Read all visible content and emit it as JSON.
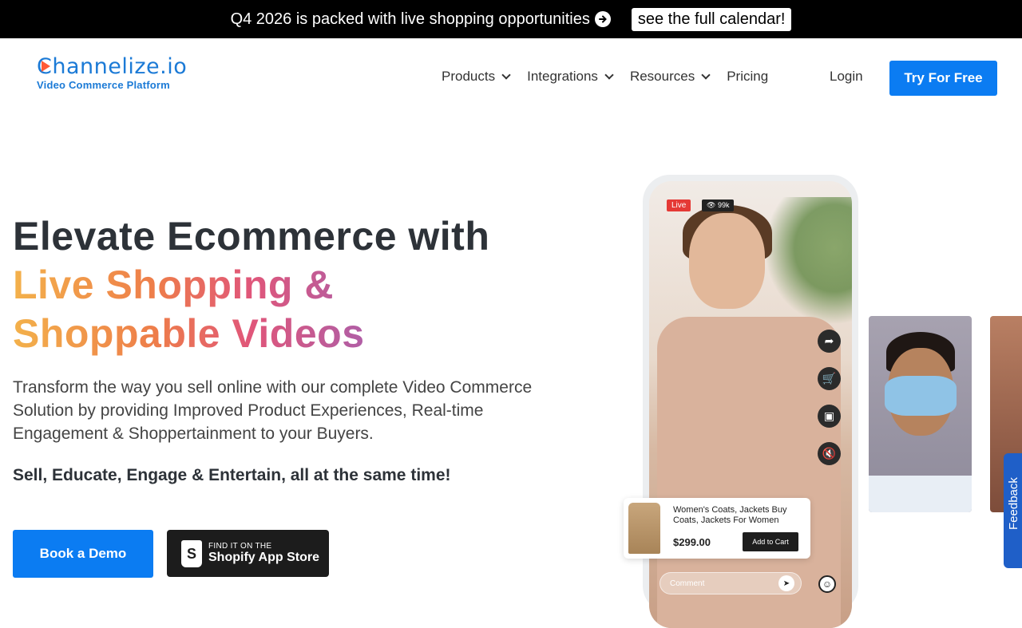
{
  "announcement": {
    "text": "Q4 2026 is packed with live shopping opportunities",
    "cta": "see the full calendar!"
  },
  "brand": {
    "name": "Channelize.io",
    "tagline": "Video Commerce Platform"
  },
  "nav": {
    "items": [
      {
        "label": "Products",
        "dropdown": true
      },
      {
        "label": "Integrations",
        "dropdown": true
      },
      {
        "label": "Resources",
        "dropdown": true
      },
      {
        "label": "Pricing",
        "dropdown": false
      }
    ],
    "login": "Login",
    "cta": "Try For Free"
  },
  "hero": {
    "title_line1": "Elevate Ecommerce with",
    "title_line2": "Live Shopping &",
    "title_line3": "Shoppable Videos",
    "description": "Transform the way you sell online with our complete Video Commerce Solution by providing Improved Product Experiences, Real-time Engagement & Shoppertainment to your Buyers.",
    "tagline": "Sell, Educate, Engage & Entertain, all at the same time!",
    "demo_button": "Book a Demo",
    "store_button": {
      "small": "FIND IT ON THE",
      "big": "Shopify App Store"
    }
  },
  "phone": {
    "live_badge": "Live",
    "views": "99k",
    "product": {
      "name": "Women's Coats, Jackets Buy Coats, Jackets For Women",
      "price": "$299.00",
      "cart_button": "Add to Cart"
    },
    "comment_placeholder": "Comment"
  },
  "feedback_tab": "Feedback",
  "colors": {
    "primary": "#0b7cf2",
    "announcement_bg": "#000000",
    "heading": "#2d3238",
    "gradient": [
      "#f3b14b",
      "#ee7d4a",
      "#e0567a",
      "#b75d9f",
      "#8a63d6"
    ]
  }
}
